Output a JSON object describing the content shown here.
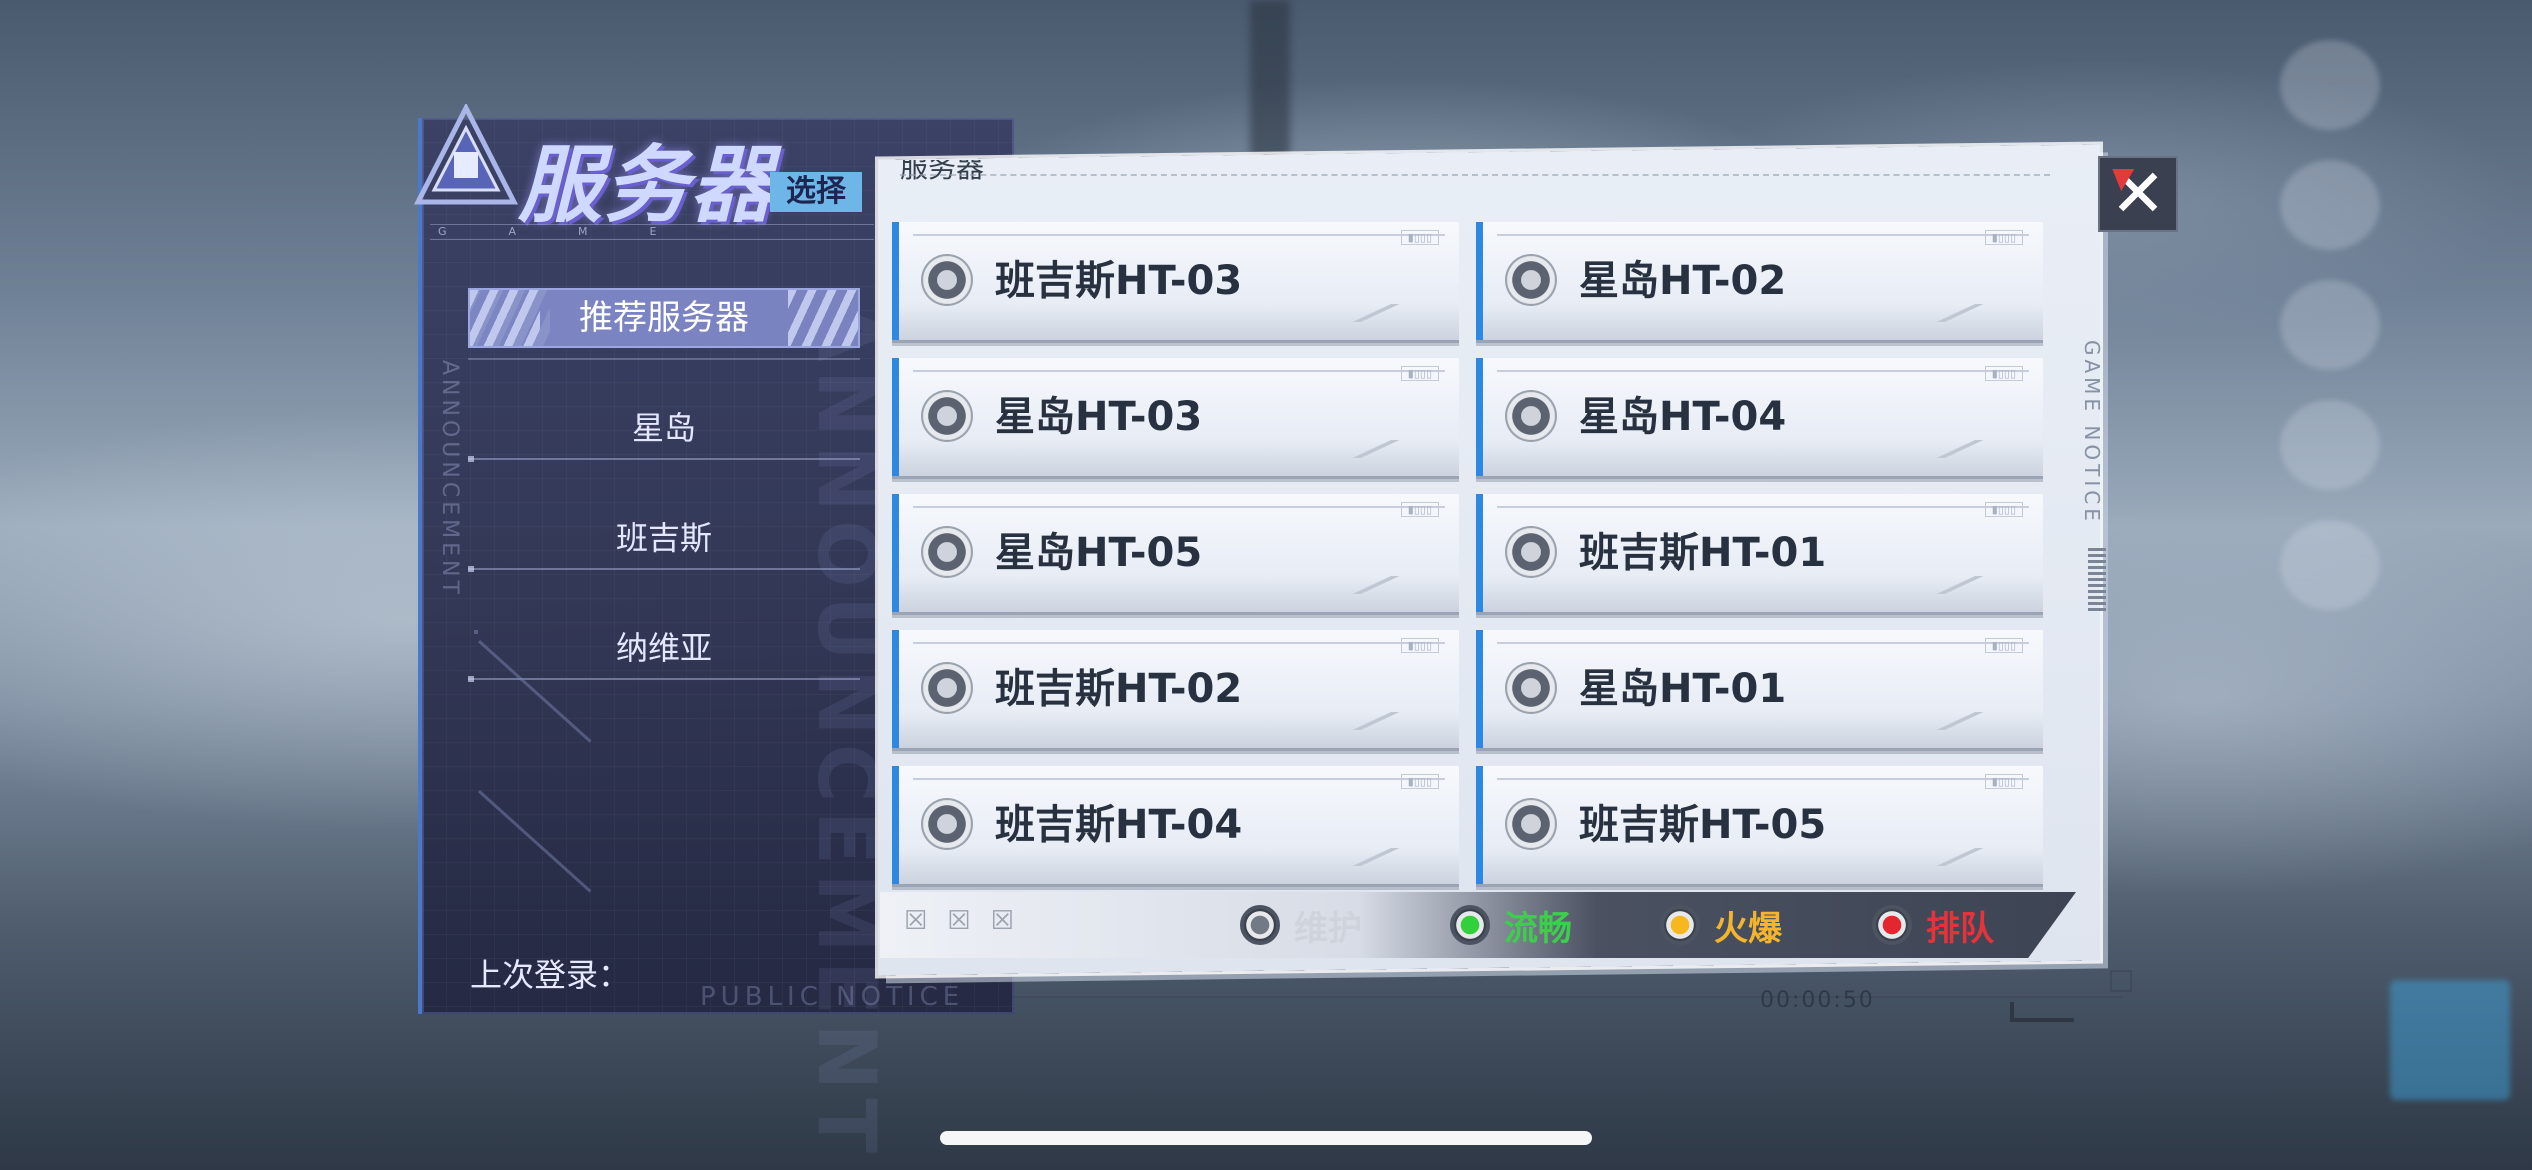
{
  "header": {
    "title": "服务器",
    "title_tag": "选择",
    "game_strip": "GAME",
    "vertical_left": "ANNOUNCEMENT",
    "vertical_watermark": "ANNOUNCEMENT",
    "public_notice": "PUBLIC NOTICE"
  },
  "categories": {
    "recommended": "推荐服务器",
    "items": [
      "星岛",
      "班吉斯",
      "纳维亚"
    ]
  },
  "last_login": {
    "label": "上次登录："
  },
  "main": {
    "header": "服务器",
    "side_label": "GAME NOTICE",
    "servers": [
      {
        "name": "班吉斯HT-03",
        "status": "maintenance"
      },
      {
        "name": "星岛HT-02",
        "status": "maintenance"
      },
      {
        "name": "星岛HT-03",
        "status": "maintenance"
      },
      {
        "name": "星岛HT-04",
        "status": "maintenance"
      },
      {
        "name": "星岛HT-05",
        "status": "maintenance"
      },
      {
        "name": "班吉斯HT-01",
        "status": "maintenance"
      },
      {
        "name": "班吉斯HT-02",
        "status": "maintenance"
      },
      {
        "name": "星岛HT-01",
        "status": "maintenance"
      },
      {
        "name": "班吉斯HT-04",
        "status": "maintenance"
      },
      {
        "name": "班吉斯HT-05",
        "status": "maintenance"
      }
    ]
  },
  "legend": {
    "maintenance": "维护",
    "smooth": "流畅",
    "hot": "火爆",
    "queue": "排队"
  },
  "footer": {
    "timer": "00:00:50"
  },
  "colors": {
    "smooth": "#3cd04a",
    "hot": "#f4b52c",
    "queue": "#e8323a",
    "maintenance": "#cfd4dc",
    "accent_blue": "#2c88e0",
    "close_red": "#e33a3a"
  },
  "icons": {
    "close": "close-x-icon",
    "logo": "game-logo-icon",
    "status": "status-dot-icon"
  }
}
